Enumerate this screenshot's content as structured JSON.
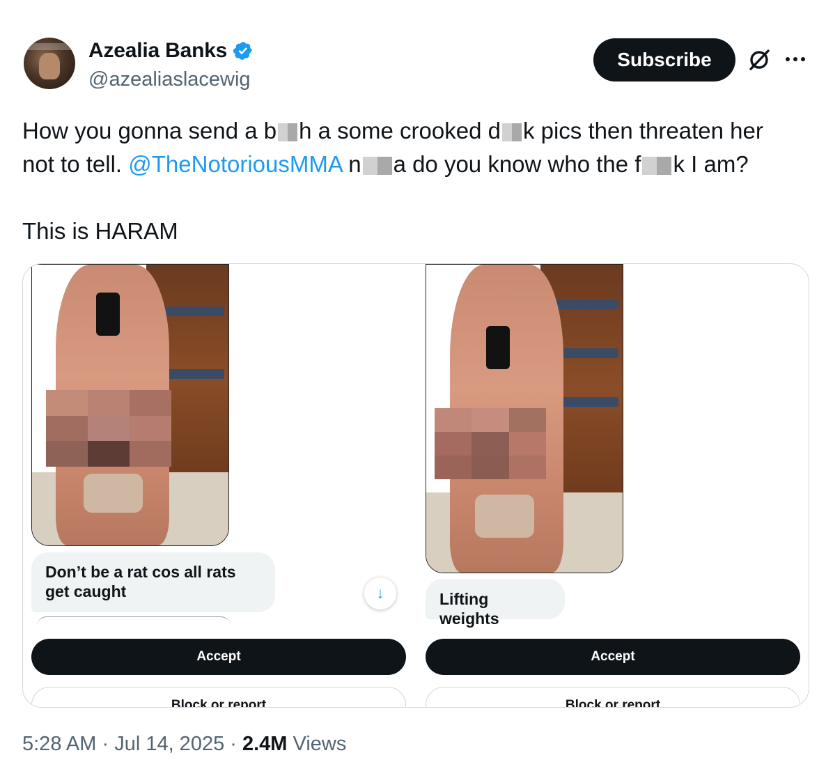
{
  "author": {
    "display_name": "Azealia Banks",
    "handle": "@azealiaslacewig"
  },
  "header": {
    "subscribe_label": "Subscribe"
  },
  "tweet": {
    "line1_a": "How you gonna send a b",
    "line1_b": "h a some crooked d",
    "line1_c": "k pics then threaten her",
    "line2_a": "not to tell. ",
    "mention": "@TheNotoriousMMA",
    "line2_b": " n",
    "line2_c": "a do you know who the f",
    "line2_d": "k I am?",
    "line3": "This is HARAM"
  },
  "media": {
    "left": {
      "message": "Don’t be a rat cos all rats get caught",
      "accept_label": "Accept",
      "block_label": "Block or report"
    },
    "right": {
      "message": "Lifting weights",
      "accept_label": "Accept",
      "block_label": "Block or report"
    },
    "scroll_icon": "↓"
  },
  "meta": {
    "time": "5:28 AM",
    "sep1": " · ",
    "date": "Jul 14, 2025",
    "sep2": " · ",
    "views_count": "2.4M",
    "views_label": " Views"
  },
  "colors": {
    "accent": "#1d9bf0",
    "text": "#0f1419",
    "muted": "#536471",
    "verified": "#1d9bf0"
  },
  "icons": [
    "verified-badge-icon",
    "grok-icon",
    "more-icon",
    "arrow-down-icon"
  ]
}
